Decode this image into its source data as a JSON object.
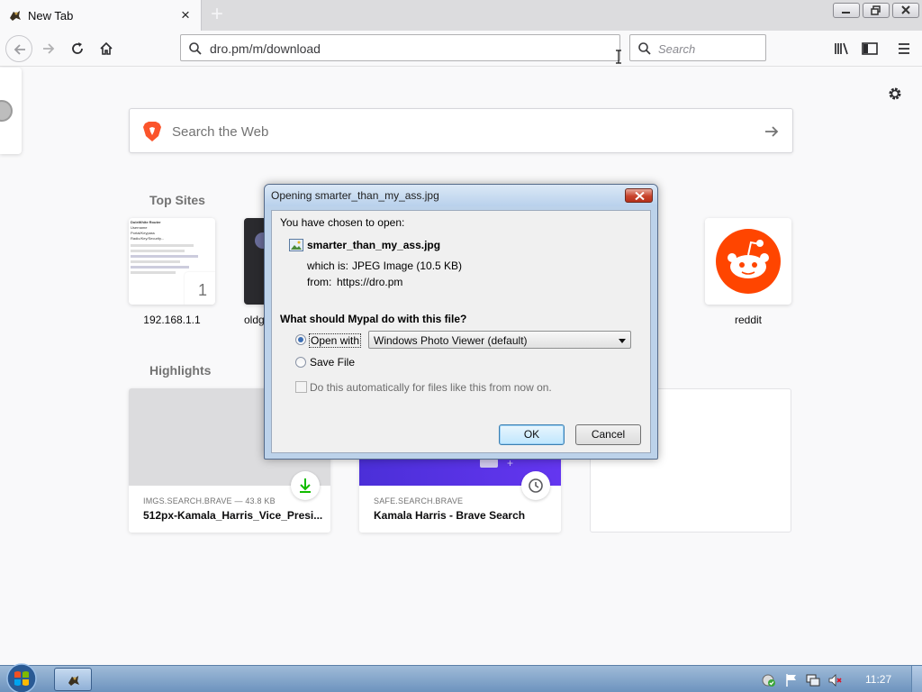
{
  "tab": {
    "title": "New Tab",
    "close": "×",
    "new_tab": "+"
  },
  "navbar": {
    "url": "dro.pm/m/download",
    "search_placeholder": "Search"
  },
  "newtab_page": {
    "search_placeholder": "Search the Web",
    "top_sites_title": "Top Sites",
    "highlights_title": "Highlights",
    "top_sites": [
      {
        "label": "192.168.1.1",
        "badge": "1"
      },
      {
        "label": "oldg"
      },
      {
        "label": "reddit"
      }
    ],
    "site1_preview_lines": [
      "DoleWhite Router",
      "Username",
      "Portal/Keypass",
      "Radio/Key/Security..."
    ],
    "highlights": [
      {
        "source": "IMGS.SEARCH.BRAVE — 43.8 KB",
        "title": "512px-Kamala_Harris_Vice_Presi..."
      },
      {
        "source": "SAFE.SEARCH.BRAVE",
        "title": "Kamala Harris - Brave Search"
      }
    ]
  },
  "dialog": {
    "title": "Opening smarter_than_my_ass.jpg",
    "chosen_label": "You have chosen to open:",
    "filename": "smarter_than_my_ass.jpg",
    "which_is_label": "which is:",
    "which_is_value": "JPEG Image (10.5 KB)",
    "from_label": "from:",
    "from_value": "https://dro.pm",
    "question": "What should Mypal do with this file?",
    "open_with_label": "Open with",
    "open_with_app": "Windows Photo Viewer (default)",
    "save_file_label": "Save File",
    "auto_label": "Do this automatically for files like this from now on.",
    "ok_label": "OK",
    "cancel_label": "Cancel",
    "selected_action": "open_with"
  },
  "taskbar": {
    "clock": "11:27"
  },
  "colors": {
    "accent": "#3c7fb1",
    "reddit": "#ff4500",
    "brave": "#fb542b",
    "highlight_purple": "#5a2fe8"
  }
}
